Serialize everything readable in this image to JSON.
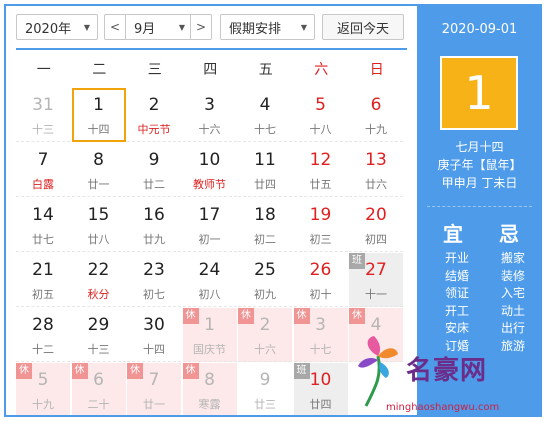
{
  "toolbar": {
    "year": "2020年",
    "month": "9月",
    "prev_icon": "chevron-left",
    "next_icon": "chevron-right",
    "holiday": "假期安排",
    "today_button": "返回今天"
  },
  "weekdays": [
    "一",
    "二",
    "三",
    "四",
    "五",
    "六",
    "日"
  ],
  "calendar": {
    "weeks": [
      [
        {
          "day": "31",
          "lunar": "十三",
          "outside": true
        },
        {
          "day": "1",
          "lunar": "十四",
          "today": true
        },
        {
          "day": "2",
          "lunar": "中元节",
          "festival": true
        },
        {
          "day": "3",
          "lunar": "十六"
        },
        {
          "day": "4",
          "lunar": "十七"
        },
        {
          "day": "5",
          "lunar": "十八"
        },
        {
          "day": "6",
          "lunar": "十九"
        }
      ],
      [
        {
          "day": "7",
          "lunar": "白露",
          "festival": true
        },
        {
          "day": "8",
          "lunar": "廿一"
        },
        {
          "day": "9",
          "lunar": "廿二"
        },
        {
          "day": "10",
          "lunar": "教师节",
          "festival": true
        },
        {
          "day": "11",
          "lunar": "廿四"
        },
        {
          "day": "12",
          "lunar": "廿五"
        },
        {
          "day": "13",
          "lunar": "廿六"
        }
      ],
      [
        {
          "day": "14",
          "lunar": "廿七"
        },
        {
          "day": "15",
          "lunar": "廿八"
        },
        {
          "day": "16",
          "lunar": "廿九"
        },
        {
          "day": "17",
          "lunar": "初一"
        },
        {
          "day": "18",
          "lunar": "初二"
        },
        {
          "day": "19",
          "lunar": "初三"
        },
        {
          "day": "20",
          "lunar": "初四"
        }
      ],
      [
        {
          "day": "21",
          "lunar": "初五"
        },
        {
          "day": "22",
          "lunar": "秋分",
          "festival": true
        },
        {
          "day": "23",
          "lunar": "初七"
        },
        {
          "day": "24",
          "lunar": "初八"
        },
        {
          "day": "25",
          "lunar": "初九"
        },
        {
          "day": "26",
          "lunar": "初十"
        },
        {
          "day": "27",
          "lunar": "十一",
          "tag": "班"
        }
      ],
      [
        {
          "day": "28",
          "lunar": "十二"
        },
        {
          "day": "29",
          "lunar": "十三"
        },
        {
          "day": "30",
          "lunar": "十四"
        },
        {
          "day": "1",
          "lunar": "国庆节",
          "outside": true,
          "tag": "休"
        },
        {
          "day": "2",
          "lunar": "十六",
          "outside": true,
          "tag": "休"
        },
        {
          "day": "3",
          "lunar": "十七",
          "outside": true,
          "tag": "休"
        },
        {
          "day": "4",
          "lunar": "",
          "outside": true,
          "tag": "休"
        }
      ],
      [
        {
          "day": "5",
          "lunar": "十九",
          "outside": true,
          "tag": "休"
        },
        {
          "day": "6",
          "lunar": "二十",
          "outside": true,
          "tag": "休"
        },
        {
          "day": "7",
          "lunar": "廿一",
          "outside": true,
          "tag": "休"
        },
        {
          "day": "8",
          "lunar": "寒露",
          "outside": true,
          "tag": "休"
        },
        {
          "day": "9",
          "lunar": "廿三",
          "outside": true
        },
        {
          "day": "10",
          "lunar": "廿四",
          "tag": "班"
        },
        {
          "day": "",
          "lunar": "",
          "outside": true
        }
      ]
    ]
  },
  "panel": {
    "date": "2020-09-01",
    "big_day": "1",
    "lunar_date": "七月十四",
    "ganzhi_year": "庚子年【鼠年】",
    "ganzhi_month_day": "甲申月 丁未日",
    "yi_label": "宜",
    "ji_label": "忌",
    "yi": [
      "开业",
      "结婚",
      "领证",
      "开工",
      "安床",
      "订婚"
    ],
    "ji": [
      "搬家",
      "装修",
      "入宅",
      "动土",
      "出行",
      "旅游"
    ]
  },
  "watermark": {
    "brand": "名豪网",
    "url": "minghaoshangwu.com"
  },
  "colors": {
    "accent": "#4e9bea",
    "today_border": "#f0a30a",
    "big_day_bg": "#f7b217",
    "holiday_red": "#e02020",
    "rest_bg": "#fde9e9",
    "work_bg": "#eeeeee"
  }
}
